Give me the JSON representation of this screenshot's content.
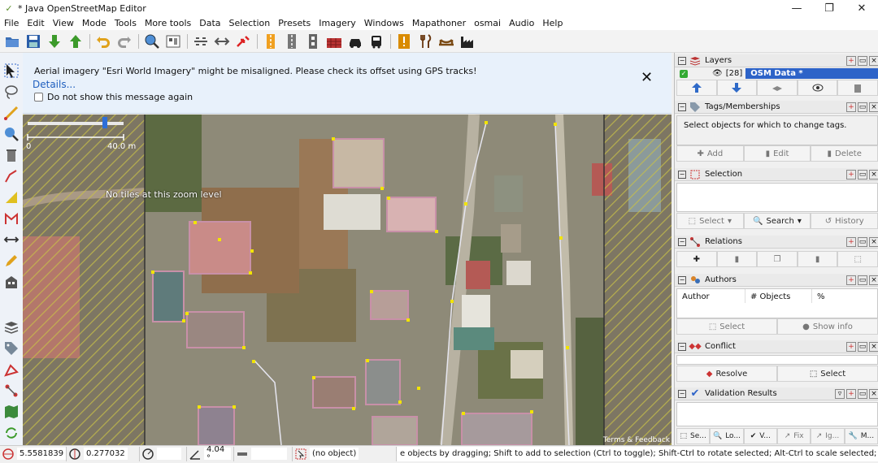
{
  "window": {
    "title": "* Java OpenStreetMap Editor"
  },
  "menu": [
    "File",
    "Edit",
    "View",
    "Mode",
    "Tools",
    "More tools",
    "Data",
    "Selection",
    "Presets",
    "Imagery",
    "Windows",
    "Mapathoner",
    "osmai",
    "Audio",
    "Help"
  ],
  "notice": {
    "message": "Aerial imagery \"Esri World Imagery\" might be misaligned. Please check its offset using GPS tracks!",
    "details": "Details...",
    "checkbox": "Do not show this message again",
    "close": "✕"
  },
  "map": {
    "scale_zero": "0",
    "scale_distance": "40.0 m",
    "no_tiles": "No tiles at this zoom level",
    "attribution": "Terms & Feedback"
  },
  "layers": {
    "title": "Layers",
    "row_count": "[28]",
    "row_name": "OSM Data *"
  },
  "tags": {
    "title": "Tags/Memberships",
    "placeholder": "Select objects for which to change tags.",
    "add": "Add",
    "edit": "Edit",
    "delete": "Delete"
  },
  "selection": {
    "title": "Selection",
    "select": "Select",
    "search": "Search",
    "history": "History"
  },
  "relations": {
    "title": "Relations"
  },
  "authors": {
    "title": "Authors",
    "col_author": "Author",
    "col_objects": "# Objects",
    "col_percent": "%",
    "select": "Select",
    "show_info": "Show info"
  },
  "conflict": {
    "title": "Conflict",
    "resolve": "Resolve",
    "select": "Select"
  },
  "validation": {
    "title": "Validation Results",
    "tabs": [
      "Se...",
      "Lo...",
      "V...",
      "Fix",
      "Ig...",
      "M..."
    ]
  },
  "status": {
    "lat": "5.5581839",
    "lon": "0.277032",
    "heading": "",
    "angle": "4.04 °",
    "object": "(no object)",
    "help": "e objects by dragging; Shift to add to selection (Ctrl to toggle); Shift-Ctrl to rotate selected; Alt-Ctrl to scale selected; or change selection"
  }
}
